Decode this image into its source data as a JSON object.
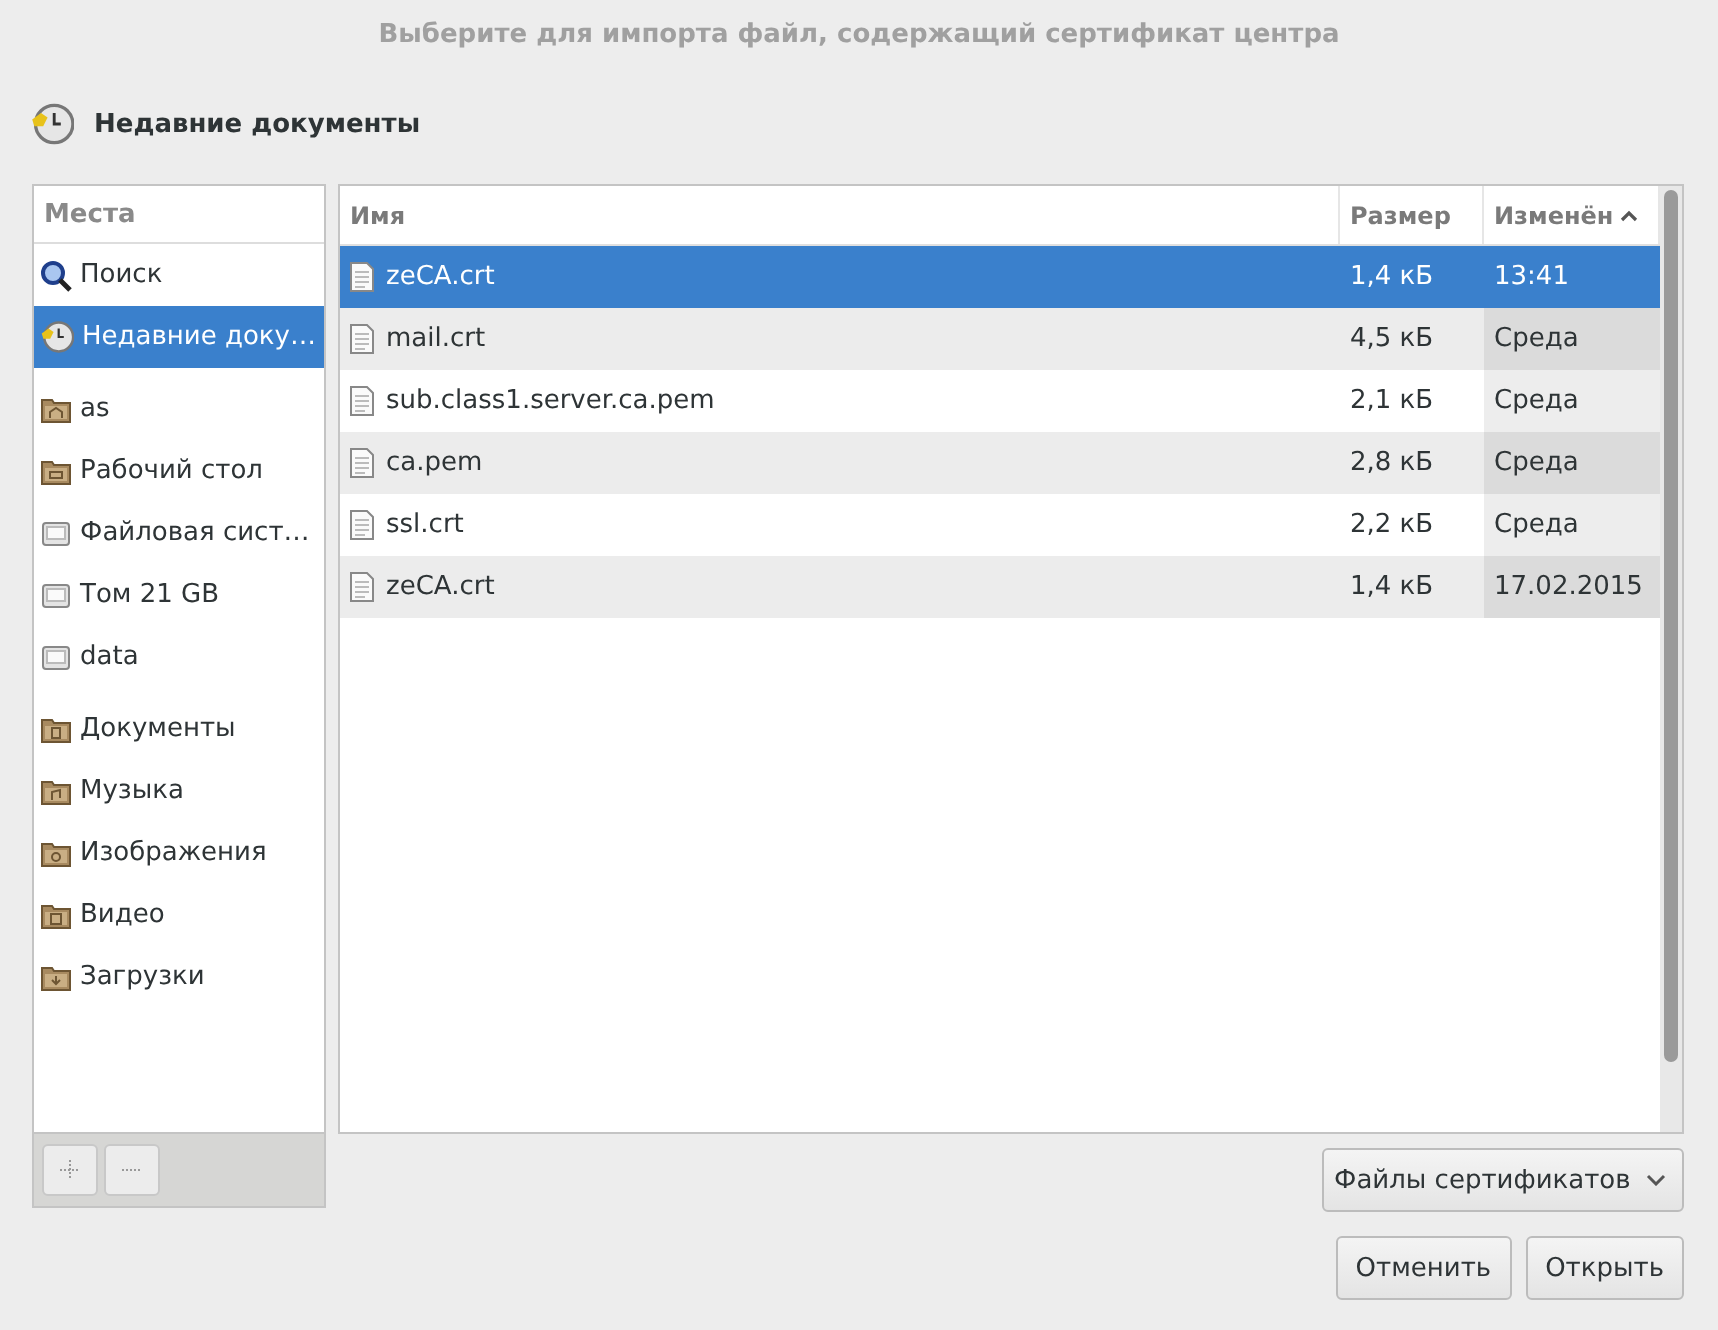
{
  "window": {
    "title": "Выберите для импорта файл, содержащий сертификат центра"
  },
  "location": {
    "label": "Недавние документы"
  },
  "sidebar": {
    "header": "Места",
    "sections": [
      {
        "items": [
          {
            "label": "Поиск",
            "kind": "search",
            "selected": false
          },
          {
            "label": "Недавние доку…",
            "kind": "recent",
            "selected": true
          }
        ]
      },
      {
        "items": [
          {
            "label": "as",
            "kind": "home",
            "selected": false
          },
          {
            "label": "Рабочий стол",
            "kind": "desktop",
            "selected": false
          },
          {
            "label": "Файловая сист…",
            "kind": "drive",
            "selected": false
          },
          {
            "label": "Том 21 GB",
            "kind": "drive",
            "selected": false
          },
          {
            "label": "data",
            "kind": "drive",
            "selected": false
          }
        ]
      },
      {
        "items": [
          {
            "label": "Документы",
            "kind": "documents",
            "selected": false
          },
          {
            "label": "Музыка",
            "kind": "music",
            "selected": false
          },
          {
            "label": "Изображения",
            "kind": "pictures",
            "selected": false
          },
          {
            "label": "Видео",
            "kind": "video",
            "selected": false
          },
          {
            "label": "Загрузки",
            "kind": "downloads",
            "selected": false
          }
        ]
      }
    ]
  },
  "table": {
    "columns": [
      {
        "label": "Имя",
        "sorted": false
      },
      {
        "label": "Размер",
        "sorted": false
      },
      {
        "label": "Изменён",
        "sorted": true
      }
    ],
    "rows": [
      {
        "name": "zeCA.crt",
        "size": "1,4 кБ",
        "modified": "13:41",
        "selected": true
      },
      {
        "name": "mail.crt",
        "size": "4,5 кБ",
        "modified": "Среда",
        "selected": false
      },
      {
        "name": "sub.class1.server.ca.pem",
        "size": "2,1 кБ",
        "modified": "Среда",
        "selected": false
      },
      {
        "name": "ca.pem",
        "size": "2,8 кБ",
        "modified": "Среда",
        "selected": false
      },
      {
        "name": "ssl.crt",
        "size": "2,2 кБ",
        "modified": "Среда",
        "selected": false
      },
      {
        "name": "zeCA.crt",
        "size": "1,4 кБ",
        "modified": "17.02.2015",
        "selected": false
      }
    ]
  },
  "filter": {
    "value": "Файлы сертификатов"
  },
  "buttons": [
    "Отменить",
    "Открыть"
  ]
}
